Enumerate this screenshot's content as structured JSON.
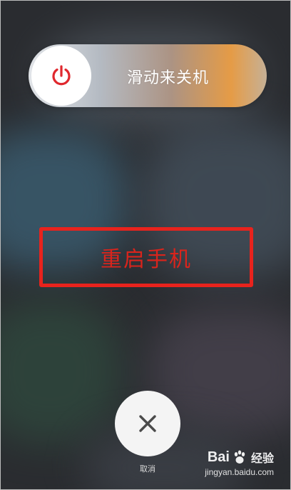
{
  "slider": {
    "label": "滑动来关机",
    "knob_icon": "power-icon",
    "icon_color": "#e0282e"
  },
  "annotation": {
    "text": "重启手机",
    "color": "#e8231d"
  },
  "cancel": {
    "icon": "close-icon",
    "label": "取消"
  },
  "watermark": {
    "brand": "Bai",
    "brand_suffix": "经验",
    "url": "jingyan.baidu.com"
  }
}
